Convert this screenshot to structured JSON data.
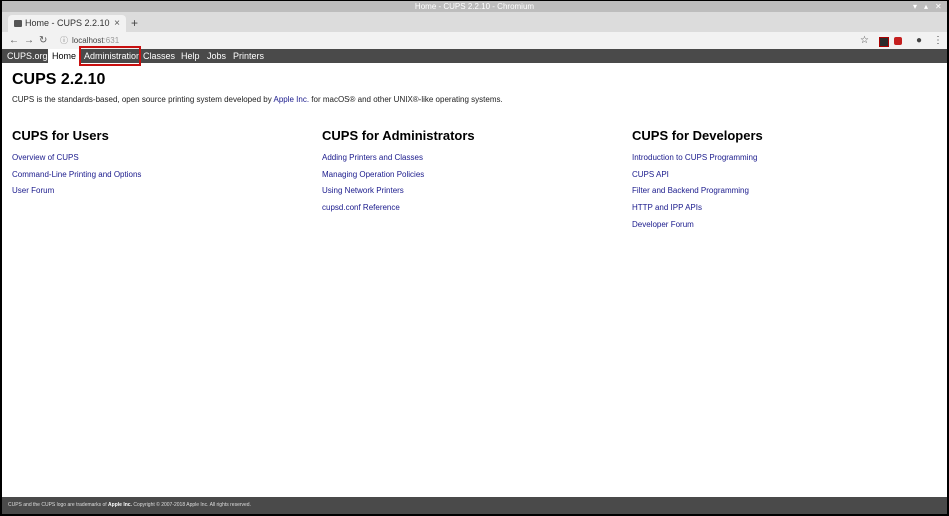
{
  "window": {
    "title": "Home - CUPS 2.2.10 - Chromium"
  },
  "tab": {
    "label": "Home - CUPS 2.2.10",
    "close": "×"
  },
  "newtab": "+",
  "address": {
    "host": "localhost",
    "port": ":631"
  },
  "cups_nav": [
    "CUPS.org",
    "Home",
    "Administration",
    "Classes",
    "Help",
    "Jobs",
    "Printers"
  ],
  "page": {
    "title": "CUPS 2.2.10",
    "intro_before": "CUPS is the standards-based, open source printing system developed by ",
    "intro_link": "Apple Inc.",
    "intro_after": " for macOS® and other UNIX®-like operating systems."
  },
  "columns": [
    {
      "title": "CUPS for Users",
      "links": [
        "Overview of CUPS",
        "Command-Line Printing and Options",
        "User Forum"
      ]
    },
    {
      "title": "CUPS for Administrators",
      "links": [
        "Adding Printers and Classes",
        "Managing Operation Policies",
        "Using Network Printers",
        "cupsd.conf Reference"
      ]
    },
    {
      "title": "CUPS for Developers",
      "links": [
        "Introduction to CUPS Programming",
        "CUPS API",
        "Filter and Backend Programming",
        "HTTP and IPP APIs",
        "Developer Forum"
      ]
    }
  ],
  "footer": {
    "before": "CUPS and the CUPS logo are trademarks of ",
    "company": "Apple Inc.",
    "after": " Copyright © 2007-2018 Apple Inc. All rights reserved."
  },
  "colors": {
    "nav_bg": "#4a4a4a",
    "link": "#1a1a8c",
    "highlight": "#c81010"
  }
}
